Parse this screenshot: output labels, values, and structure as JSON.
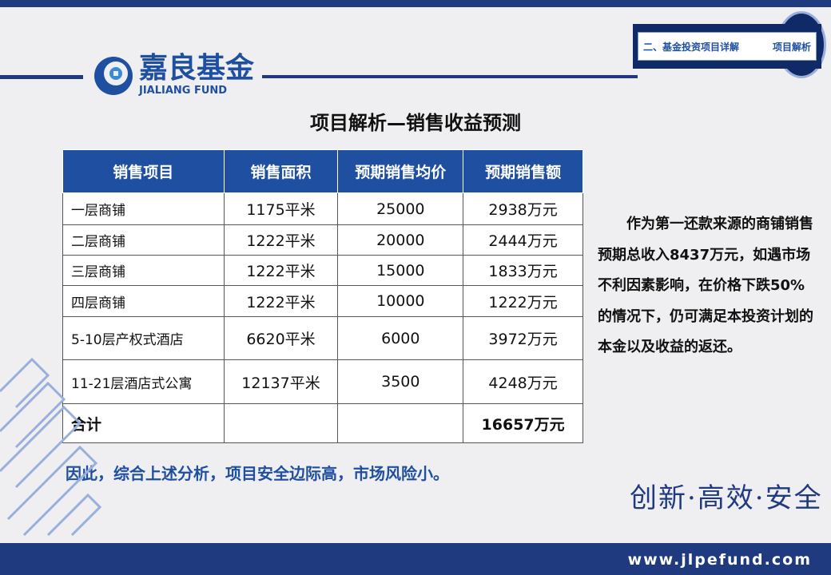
{
  "header": {
    "badge_left": "二、基金投资项目详解",
    "badge_right": "项目解析"
  },
  "logo": {
    "name": "嘉良基金",
    "en": "JIALIANG FUND"
  },
  "title": "项目解析—销售收益预测",
  "table": {
    "headers": [
      "销售项目",
      "销售面积",
      "预期销售均价",
      "预期销售额"
    ],
    "rows": [
      [
        "一层商铺",
        "1175平米",
        "25000",
        "2938万元"
      ],
      [
        "二层商铺",
        "1222平米",
        "20000",
        "2444万元"
      ],
      [
        "三层商铺",
        "1222平米",
        "15000",
        "1833万元"
      ],
      [
        "四层商铺",
        "1222平米",
        "10000",
        "1222万元"
      ],
      [
        "5-10层产权式酒店",
        "6620平米",
        "6000",
        "3972万元"
      ],
      [
        "11-21层酒店式公寓",
        "12137平米",
        "3500",
        "4248万元"
      ]
    ],
    "total": {
      "label": "合计",
      "area": "",
      "price": "",
      "amount": "16657万元"
    }
  },
  "side_text": "　　作为第一还款来源的商铺销售预期总收入8437万元，如遇市场不利因素影响，在价格下跌50%的情况下，仍可满足本投资计划的本金以及收益的返还。",
  "conclusion": "因此，综合上述分析，项目安全边际高，市场风险小。",
  "slogan": "创新·高效·安全",
  "footer": {
    "url": "www.jlpefund.com"
  }
}
